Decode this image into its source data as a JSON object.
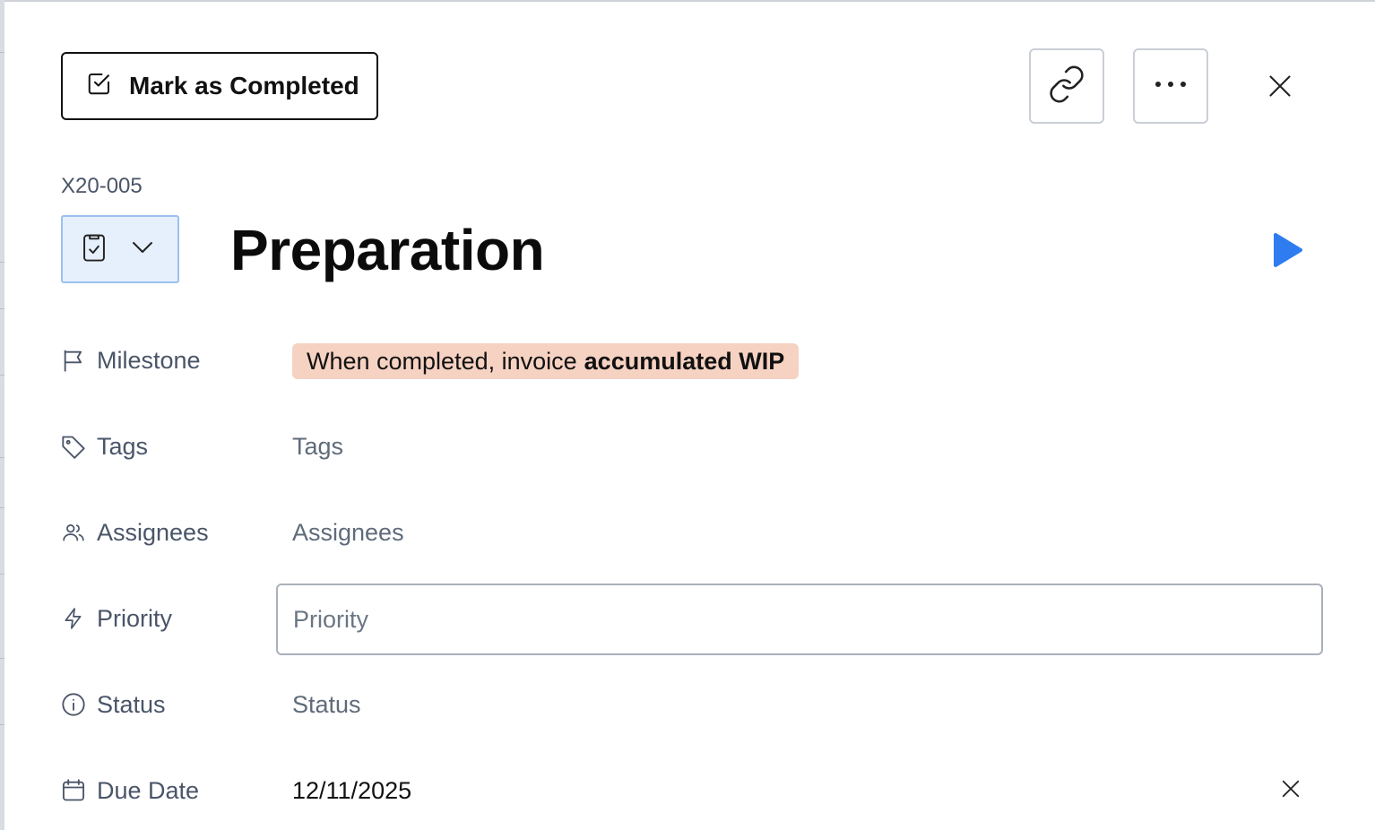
{
  "header": {
    "mark_completed_label": "Mark as Completed",
    "link_icon": "link-icon",
    "more_icon": "more-horizontal-icon",
    "close_icon": "close-icon"
  },
  "task": {
    "code": "X20-005",
    "type_icon": "clipboard-check-icon",
    "title": "Preparation",
    "play_icon": "play-icon"
  },
  "fields": {
    "milestone": {
      "label": "Milestone",
      "icon": "flag-icon",
      "badge_prefix": "When completed, invoice",
      "badge_emphasis": "accumulated WIP",
      "badge_color": "#f6d2c2"
    },
    "tags": {
      "label": "Tags",
      "icon": "tag-icon",
      "placeholder": "Tags"
    },
    "assignees": {
      "label": "Assignees",
      "icon": "users-icon",
      "placeholder": "Assignees"
    },
    "priority": {
      "label": "Priority",
      "icon": "lightning-icon",
      "placeholder": "Priority"
    },
    "status": {
      "label": "Status",
      "icon": "info-icon",
      "placeholder": "Status"
    },
    "due_date": {
      "label": "Due Date",
      "icon": "calendar-icon",
      "value": "12/11/2025"
    }
  },
  "colors": {
    "accent_blue": "#2f7cf0",
    "type_bg": "#e6f0fd"
  }
}
